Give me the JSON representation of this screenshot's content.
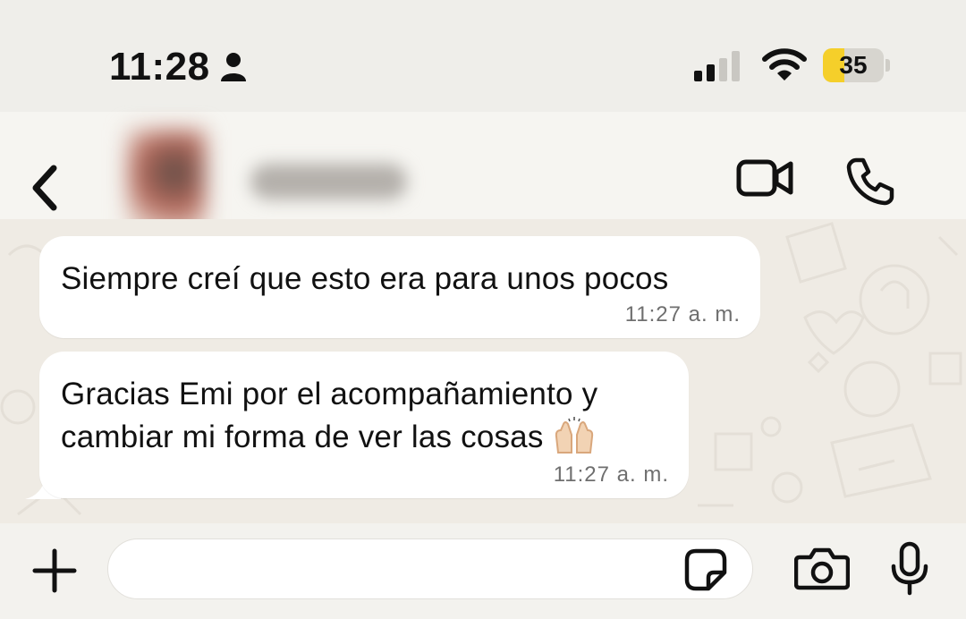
{
  "status_bar": {
    "time": "11:28",
    "battery_level": "35",
    "battery_fraction": 0.35,
    "battery_color": "#f5cf2a",
    "icons": [
      "person-icon",
      "signal-icon",
      "wifi-icon",
      "battery-icon"
    ]
  },
  "header": {
    "contact_name": "",
    "icons": [
      "back-icon",
      "video-call-icon",
      "phone-icon"
    ]
  },
  "messages": [
    {
      "text": "Siempre creí que esto era para unos pocos",
      "time": "11:27 a. m."
    },
    {
      "text": "Gracias Emi por el acompañamiento y\ncambiar mi forma de ver las cosas",
      "emoji": "raising-hands-icon",
      "time": "11:27 a. m."
    }
  ],
  "input_bar": {
    "placeholder": "",
    "icons": [
      "plus-icon",
      "sticker-icon",
      "camera-icon",
      "microphone-icon"
    ]
  }
}
